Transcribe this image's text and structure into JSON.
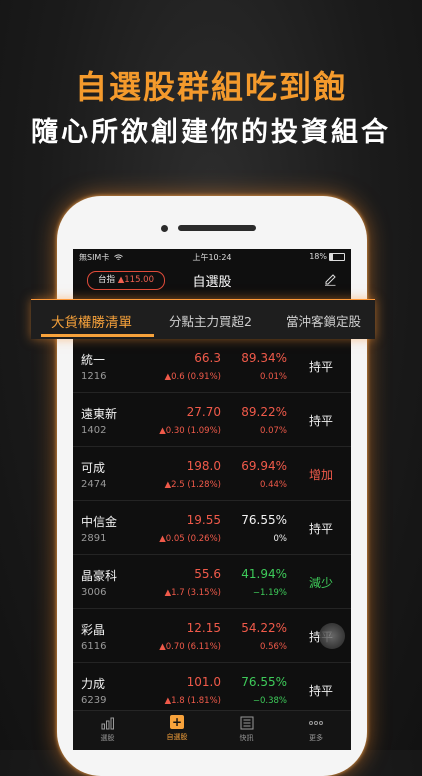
{
  "promo": {
    "title": "自選股群組吃到飽",
    "subtitle": "隨心所欲創建你的投資組合"
  },
  "status_bar": {
    "carrier": "無SIM卡",
    "time": "上午10:24",
    "battery": "18%"
  },
  "header": {
    "index_label": "台指",
    "index_value": "▲115.00",
    "title": "自選股",
    "edit_icon": "edit-pencil-icon"
  },
  "tabs": [
    {
      "label": "大貨權勝清單",
      "active": true
    },
    {
      "label": "分點主力買超2",
      "active": false
    },
    {
      "label": "當沖客鎖定股",
      "active": false
    }
  ],
  "stocks": [
    {
      "name": "統一",
      "code": "1216",
      "price": "66.3",
      "change": "▲0.6 (0.91%)",
      "pct": "89.34%",
      "pct_change": "0.01%",
      "status": "持平",
      "price_color": "red",
      "pct_color": "red",
      "status_color": "white"
    },
    {
      "name": "遠東新",
      "code": "1402",
      "price": "27.70",
      "change": "▲0.30 (1.09%)",
      "pct": "89.22%",
      "pct_change": "0.07%",
      "status": "持平",
      "price_color": "red",
      "pct_color": "red",
      "status_color": "white"
    },
    {
      "name": "可成",
      "code": "2474",
      "price": "198.0",
      "change": "▲2.5 (1.28%)",
      "pct": "69.94%",
      "pct_change": "0.44%",
      "status": "增加",
      "price_color": "red",
      "pct_color": "red",
      "status_color": "red"
    },
    {
      "name": "中信金",
      "code": "2891",
      "price": "19.55",
      "change": "▲0.05 (0.26%)",
      "pct": "76.55%",
      "pct_change": "0%",
      "status": "持平",
      "price_color": "red",
      "pct_color": "white",
      "status_color": "white"
    },
    {
      "name": "晶豪科",
      "code": "3006",
      "price": "55.6",
      "change": "▲1.7 (3.15%)",
      "pct": "41.94%",
      "pct_change": "−1.19%",
      "status": "減少",
      "price_color": "red",
      "pct_color": "green",
      "status_color": "green"
    },
    {
      "name": "彩晶",
      "code": "6116",
      "price": "12.15",
      "change": "▲0.70 (6.11%)",
      "pct": "54.22%",
      "pct_change": "0.56%",
      "status": "持平",
      "price_color": "red",
      "pct_color": "red",
      "status_color": "white"
    },
    {
      "name": "力成",
      "code": "6239",
      "price": "101.0",
      "change": "▲1.8 (1.81%)",
      "pct": "76.55%",
      "pct_change": "−0.38%",
      "status": "持平",
      "price_color": "red",
      "pct_color": "green",
      "status_color": "white"
    }
  ],
  "bottom_nav": [
    {
      "label": "選股",
      "icon": "chart-bars-icon",
      "active": false
    },
    {
      "label": "自選股",
      "icon": "add-square-icon",
      "active": true
    },
    {
      "label": "快訊",
      "icon": "newspaper-icon",
      "active": false
    },
    {
      "label": "更多",
      "icon": "more-dots-icon",
      "active": false
    }
  ],
  "colors": {
    "accent": "#f7a23b",
    "up": "#f05a4a",
    "down": "#3ecb5a"
  }
}
